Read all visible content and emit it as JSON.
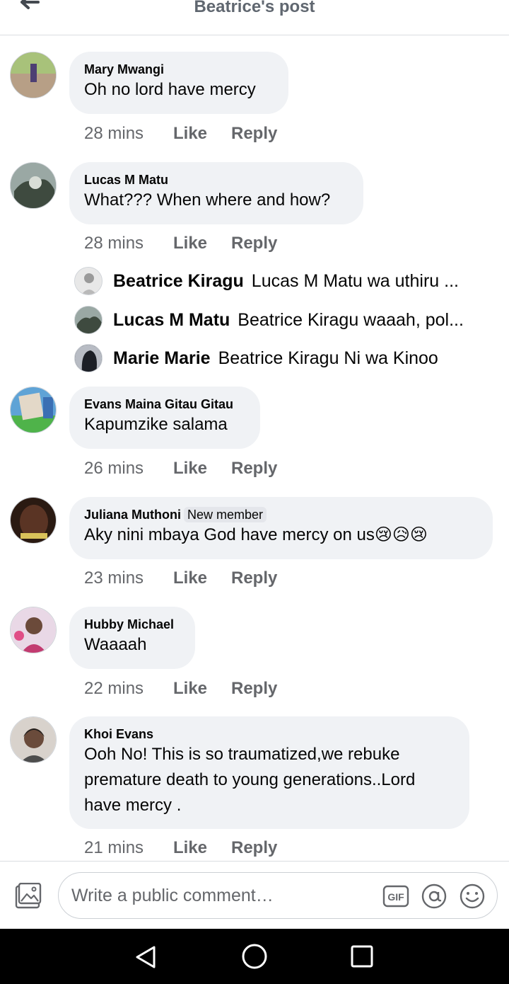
{
  "header": {
    "title": "Beatrice's post"
  },
  "comments": [
    {
      "author": "Mary Mwangi",
      "text": "Oh no lord have mercy",
      "time": "28 mins",
      "like": "Like",
      "reply": "Reply"
    },
    {
      "author": "Lucas M Matu",
      "text": "What??? When where and how?",
      "time": "28 mins",
      "like": "Like",
      "reply": "Reply",
      "replies": [
        {
          "author": "Beatrice Kiragu",
          "text": "Lucas M Matu wa uthiru ..."
        },
        {
          "author": "Lucas M Matu",
          "text": "Beatrice Kiragu waaah, pol..."
        },
        {
          "author": "Marie Marie",
          "text": "Beatrice Kiragu Ni wa Kinoo"
        }
      ]
    },
    {
      "author": "Evans Maina Gitau Gitau",
      "text": "Kapumzike salama",
      "time": "26 mins",
      "like": "Like",
      "reply": "Reply"
    },
    {
      "author": "Juliana Muthoni",
      "badge": "New member",
      "text": "Aky nini mbaya God have mercy on us😢😥😢",
      "time": "23 mins",
      "like": "Like",
      "reply": "Reply"
    },
    {
      "author": "Hubby Michael",
      "text": "Waaaah",
      "time": "22 mins",
      "like": "Like",
      "reply": "Reply"
    },
    {
      "author": "Khoi Evans",
      "text_lines": [
        "Ooh No! This is so traumatized,we rebuke",
        "premature death to young generations..Lord",
        "have mercy ."
      ],
      "time": "21 mins",
      "like": "Like",
      "reply": "Reply"
    }
  ],
  "composer": {
    "placeholder": "Write a public comment…",
    "gif_label": "GIF"
  },
  "icons": {
    "back": "arrow-left-icon",
    "photo": "photo-icon",
    "gif": "gif-icon",
    "mention": "at-sign-icon",
    "emoji": "smiley-icon",
    "nav_back": "triangle-back-icon",
    "nav_home": "circle-home-icon",
    "nav_recent": "square-recents-icon"
  },
  "colors": {
    "bubble": "#f0f2f5",
    "meta": "#65676b",
    "header_title": "#606770",
    "navbar": "#000000"
  }
}
